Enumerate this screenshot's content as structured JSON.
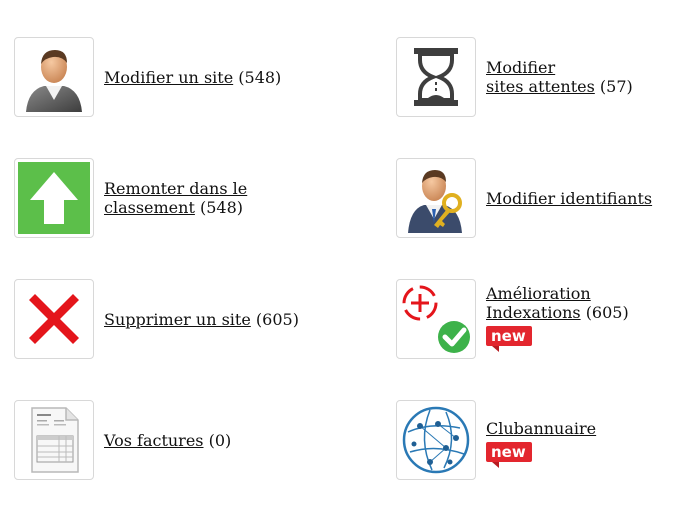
{
  "items": [
    {
      "label": "Modifier un site",
      "count": "(548)"
    },
    {
      "label_line1": "Modifier",
      "label_line2": "sites attentes",
      "count": "(57)"
    },
    {
      "label_line1": "Remonter dans le",
      "label_line2": "classement",
      "count": "(548)"
    },
    {
      "label": "Modifier identifiants"
    },
    {
      "label": "Supprimer un site",
      "count": "(605)"
    },
    {
      "label_line1": "Amélioration",
      "label_line2": "Indexations",
      "count": "(605)",
      "badge": "new"
    },
    {
      "label": "Vos factures",
      "count": "(0)"
    },
    {
      "label": "Clubannuaire",
      "badge": "new"
    }
  ],
  "icons": {
    "user": "user-icon",
    "hourglass": "hourglass-icon",
    "arrow": "arrow-up-icon",
    "user_key": "user-key-icon",
    "delete": "cross-icon",
    "target": "target-check-icon",
    "invoice": "invoice-icon",
    "network": "globe-network-icon"
  },
  "colors": {
    "accent_green": "#5cbf4a",
    "delete_red": "#e4151b",
    "badge_red": "#e3262e"
  }
}
